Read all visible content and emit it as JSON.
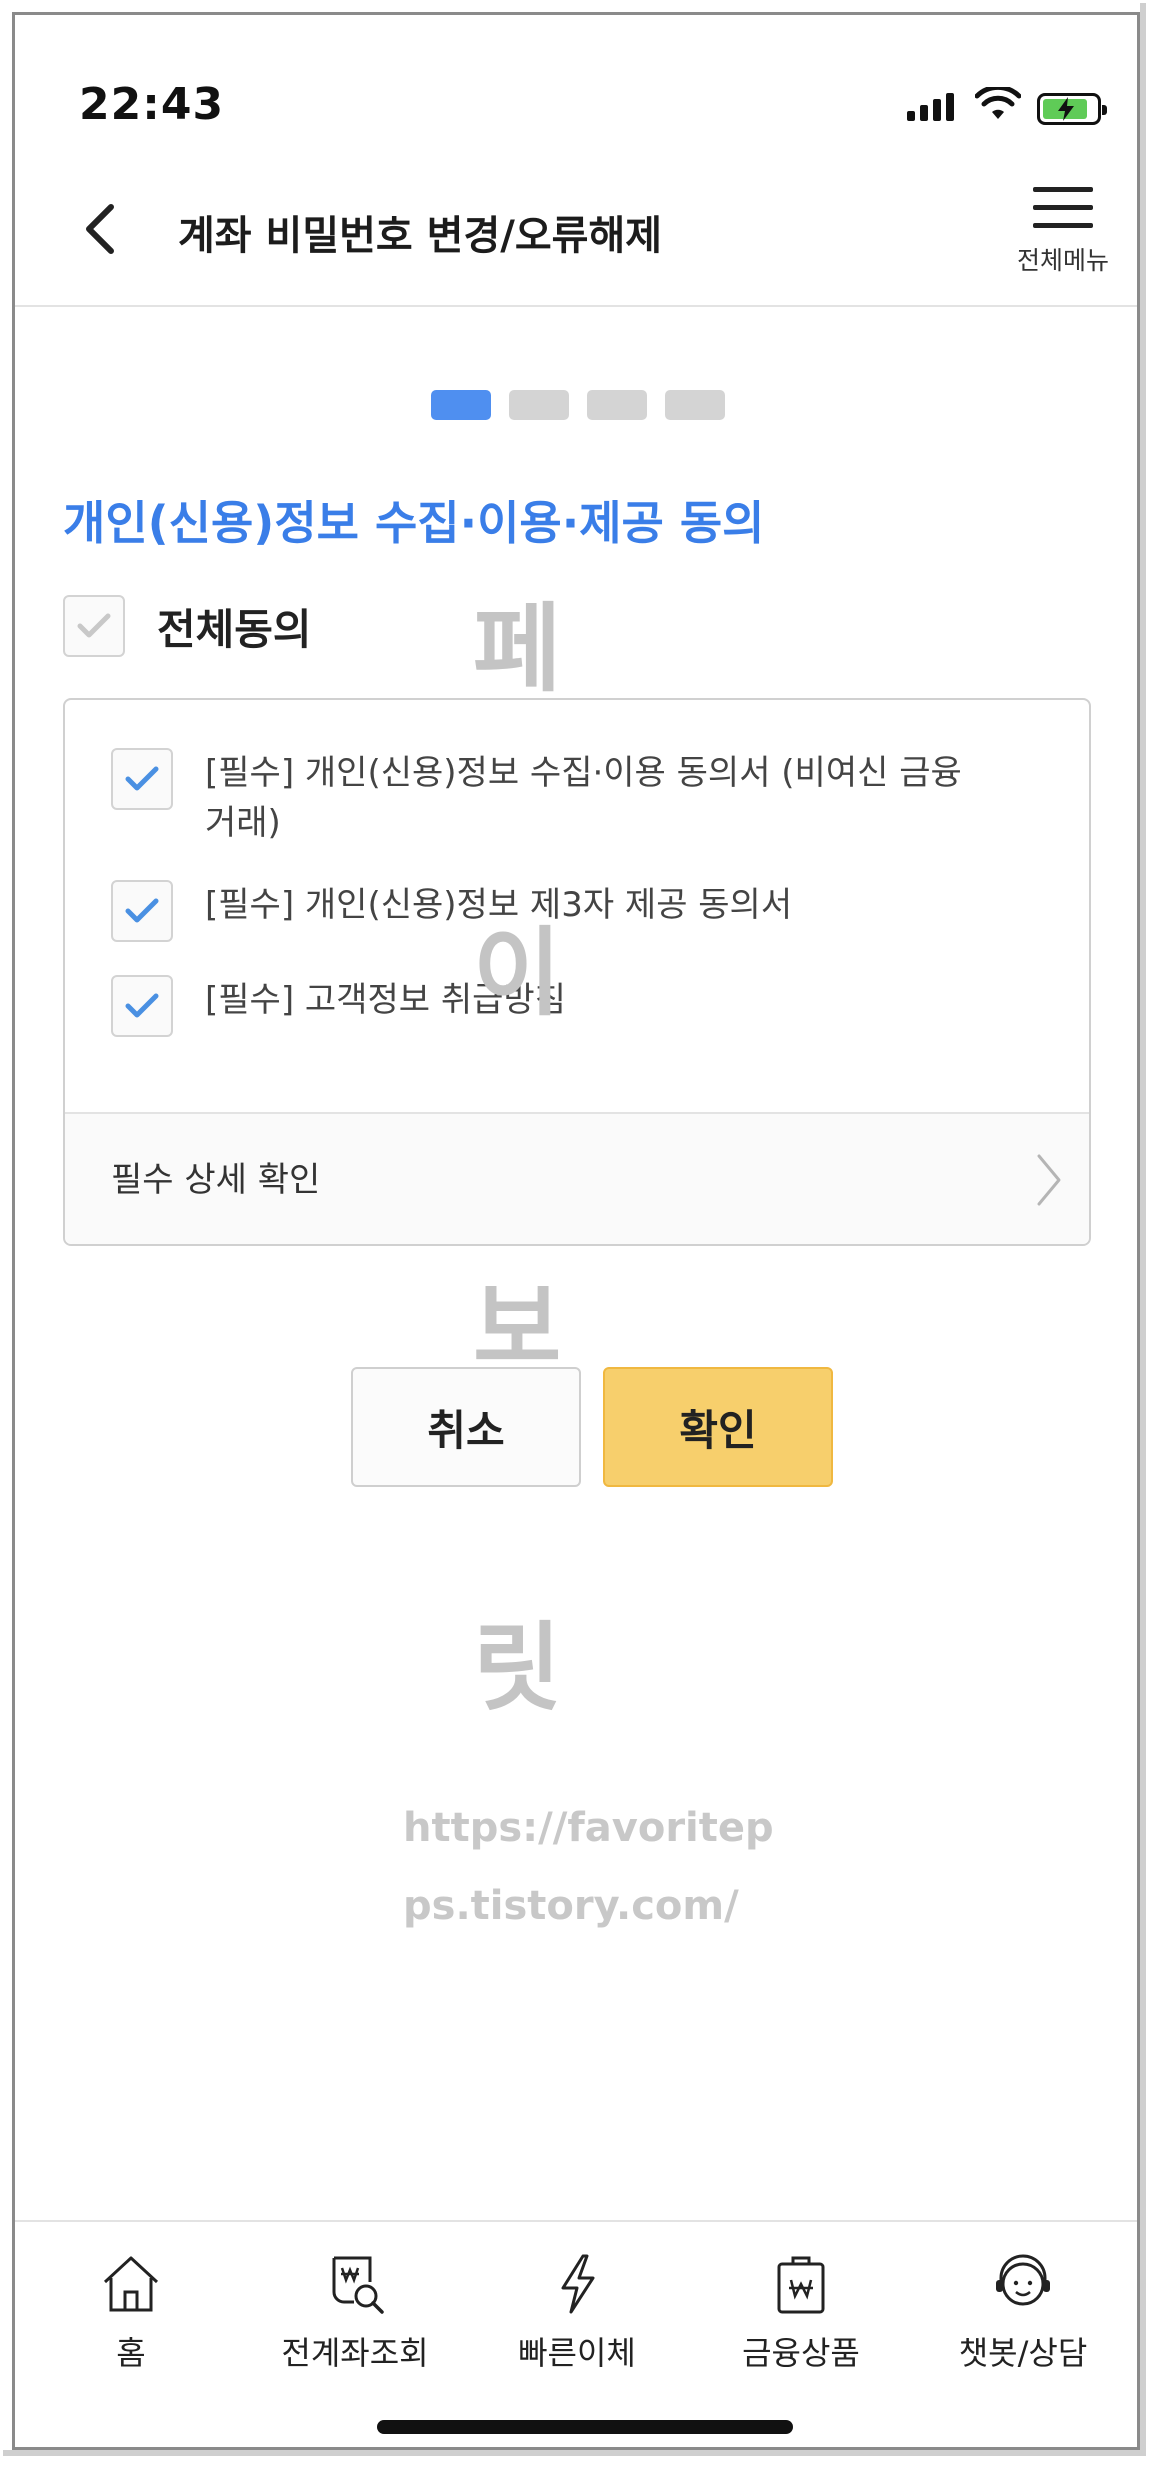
{
  "status_bar": {
    "time": "22:43"
  },
  "header": {
    "title": "계좌 비밀번호 변경/오류해제",
    "menu_label": "전체메뉴"
  },
  "steps": {
    "total": 4,
    "current": 1
  },
  "consent": {
    "section_title": "개인(신용)정보 수집·이용·제공 동의",
    "agree_all_label": "전체동의",
    "items": [
      {
        "label": "[필수] 개인(신용)정보 수집·이용 동의서 (비여신 금융거래)",
        "checked": true
      },
      {
        "label": "[필수] 개인(신용)정보 제3자 제공 동의서",
        "checked": true
      },
      {
        "label": "[필수] 고객정보 취급방침",
        "checked": true
      }
    ],
    "detail_label": "필수 상세 확인"
  },
  "buttons": {
    "cancel_label": "취소",
    "confirm_label": "확인"
  },
  "watermark": {
    "chars": [
      "페",
      "이",
      "보",
      "릿"
    ],
    "url_line1": "https://favoritep",
    "url_line2": "ps.tistory.com/"
  },
  "tab_bar": {
    "items": [
      {
        "label": "홈",
        "icon": "home-icon"
      },
      {
        "label": "전계좌조회",
        "icon": "account-search-icon"
      },
      {
        "label": "빠른이체",
        "icon": "lightning-icon"
      },
      {
        "label": "금융상품",
        "icon": "product-bag-icon"
      },
      {
        "label": "챗봇/상담",
        "icon": "chatbot-agent-icon"
      }
    ]
  },
  "colors": {
    "accent_blue": "#3a7ee8",
    "confirm_yellow": "#f7cf6c",
    "check_blue": "#4a90e2"
  }
}
